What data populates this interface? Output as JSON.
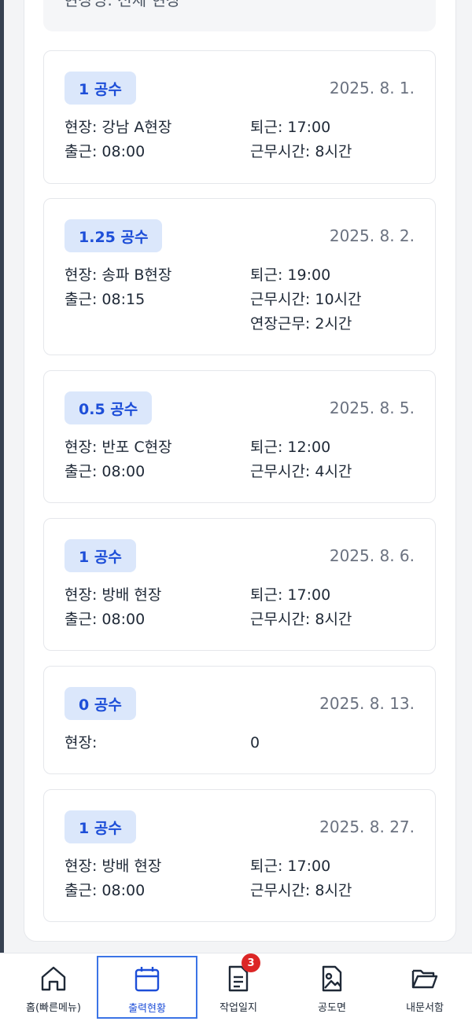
{
  "filter": {
    "text": "현장명: 전체 현장"
  },
  "records": [
    {
      "badge": "1 공수",
      "date": "2025. 8. 1.",
      "left": [
        "현장: 강남 A현장",
        "출근: 08:00"
      ],
      "right": [
        "퇴근: 17:00",
        "근무시간: 8시간"
      ]
    },
    {
      "badge": "1.25 공수",
      "date": "2025. 8. 2.",
      "left": [
        "현장: 송파 B현장",
        "출근: 08:15"
      ],
      "right": [
        "퇴근: 19:00",
        "근무시간: 10시간",
        "연장근무: 2시간"
      ]
    },
    {
      "badge": "0.5 공수",
      "date": "2025. 8. 5.",
      "left": [
        "현장: 반포 C현장",
        "출근: 08:00"
      ],
      "right": [
        "퇴근: 12:00",
        "근무시간: 4시간"
      ]
    },
    {
      "badge": "1 공수",
      "date": "2025. 8. 6.",
      "left": [
        "현장: 방배 현장",
        "출근: 08:00"
      ],
      "right": [
        "퇴근: 17:00",
        "근무시간: 8시간"
      ]
    },
    {
      "badge": "0 공수",
      "date": "2025. 8. 13.",
      "left": [
        "현장:"
      ],
      "right": [
        "0"
      ]
    },
    {
      "badge": "1 공수",
      "date": "2025. 8. 27.",
      "left": [
        "현장: 방배 현장",
        "출근: 08:00"
      ],
      "right": [
        "퇴근: 17:00",
        "근무시간: 8시간"
      ]
    }
  ],
  "nav": {
    "items": [
      {
        "label": "홈(빠른메뉴)",
        "icon": "home-icon"
      },
      {
        "label": "출력현황",
        "icon": "calendar-icon",
        "active": true
      },
      {
        "label": "작업일지",
        "icon": "document-icon",
        "badge": "3"
      },
      {
        "label": "공도면",
        "icon": "drawing-file-icon"
      },
      {
        "label": "내문서함",
        "icon": "folder-icon"
      }
    ]
  },
  "colors": {
    "accent": "#1d4ed8",
    "badge_bg": "#dbe7fb",
    "notify": "#dc2626"
  }
}
